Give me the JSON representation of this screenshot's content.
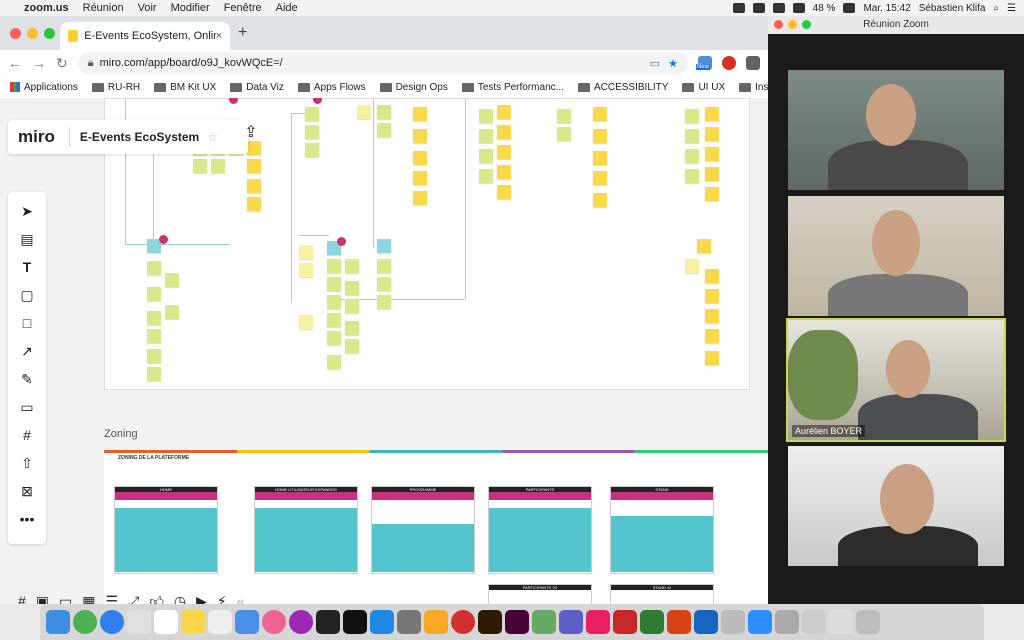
{
  "menubar": {
    "app": "zoom.us",
    "items": [
      "Réunion",
      "Voir",
      "Modifier",
      "Fenêtre",
      "Aide"
    ],
    "battery": "48 %",
    "clock": "Mar. 15:42",
    "user": "Sébastien Klifa"
  },
  "browser": {
    "tab_title": "E-Events EcoSystem, Online W",
    "tab_close": "×",
    "new_tab": "+",
    "url": "miro.com/app/board/o9J_kovWQcE=/",
    "ext_label": "New",
    "bookmarks": [
      "Applications",
      "RU-RH",
      "BM Kit UX",
      "Data Viz",
      "Apps Flows",
      "Design Ops",
      "Tests Performanc...",
      "ACCESSIBILITY",
      "UI UX",
      "Inspi Research"
    ]
  },
  "miro": {
    "logo": "miro",
    "board_name": "E-Events EcoSystem",
    "zoning_label": "Zoning",
    "zoning_title": "ZONING DE LA PLATEFORME",
    "frame_titles": [
      "HOME",
      "HOME UTILISATEUR EXPANDED",
      "PROGRAMME",
      "PARTICIPANTS",
      "STAND",
      "PARTICIPANTS V2",
      "STAND v2"
    ]
  },
  "zoom": {
    "window_title": "Réunion Zoom",
    "participants": [
      {
        "name": ""
      },
      {
        "name": ""
      },
      {
        "name": "Aurélien BOYER",
        "active": true
      },
      {
        "name": ""
      }
    ]
  }
}
